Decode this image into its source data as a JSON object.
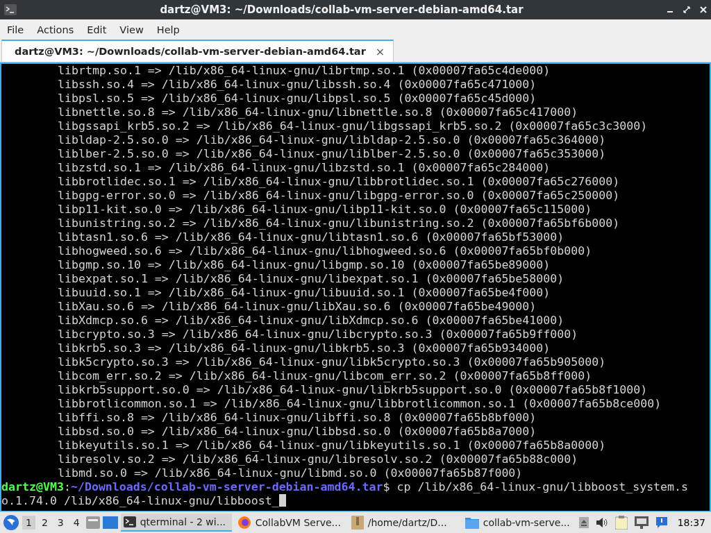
{
  "window": {
    "title": "dartz@VM3: ~/Downloads/collab-vm-server-debian-amd64.tar"
  },
  "menu": [
    "File",
    "Actions",
    "Edit",
    "View",
    "Help"
  ],
  "tabs": [
    {
      "label": "dartz@VM3: ~/Downloads/collab-vm-server-debian-amd64.tar",
      "selected": true,
      "close": "×"
    }
  ],
  "terminal": {
    "lines": [
      "librtmp.so.1 => /lib/x86_64-linux-gnu/librtmp.so.1 (0x00007fa65c4de000)",
      "libssh.so.4 => /lib/x86_64-linux-gnu/libssh.so.4 (0x00007fa65c471000)",
      "libpsl.so.5 => /lib/x86_64-linux-gnu/libpsl.so.5 (0x00007fa65c45d000)",
      "libnettle.so.8 => /lib/x86_64-linux-gnu/libnettle.so.8 (0x00007fa65c417000)",
      "libgssapi_krb5.so.2 => /lib/x86_64-linux-gnu/libgssapi_krb5.so.2 (0x00007fa65c3c3000)",
      "libldap-2.5.so.0 => /lib/x86_64-linux-gnu/libldap-2.5.so.0 (0x00007fa65c364000)",
      "liblber-2.5.so.0 => /lib/x86_64-linux-gnu/liblber-2.5.so.0 (0x00007fa65c353000)",
      "libzstd.so.1 => /lib/x86_64-linux-gnu/libzstd.so.1 (0x00007fa65c284000)",
      "libbrotlidec.so.1 => /lib/x86_64-linux-gnu/libbrotlidec.so.1 (0x00007fa65c276000)",
      "libgpg-error.so.0 => /lib/x86_64-linux-gnu/libgpg-error.so.0 (0x00007fa65c250000)",
      "libp11-kit.so.0 => /lib/x86_64-linux-gnu/libp11-kit.so.0 (0x00007fa65c115000)",
      "libunistring.so.2 => /lib/x86_64-linux-gnu/libunistring.so.2 (0x00007fa65bf6b000)",
      "libtasn1.so.6 => /lib/x86_64-linux-gnu/libtasn1.so.6 (0x00007fa65bf53000)",
      "libhogweed.so.6 => /lib/x86_64-linux-gnu/libhogweed.so.6 (0x00007fa65bf0b000)",
      "libgmp.so.10 => /lib/x86_64-linux-gnu/libgmp.so.10 (0x00007fa65be89000)",
      "libexpat.so.1 => /lib/x86_64-linux-gnu/libexpat.so.1 (0x00007fa65be58000)",
      "libuuid.so.1 => /lib/x86_64-linux-gnu/libuuid.so.1 (0x00007fa65be4f000)",
      "libXau.so.6 => /lib/x86_64-linux-gnu/libXau.so.6 (0x00007fa65be49000)",
      "libXdmcp.so.6 => /lib/x86_64-linux-gnu/libXdmcp.so.6 (0x00007fa65be41000)",
      "libcrypto.so.3 => /lib/x86_64-linux-gnu/libcrypto.so.3 (0x00007fa65b9ff000)",
      "libkrb5.so.3 => /lib/x86_64-linux-gnu/libkrb5.so.3 (0x00007fa65b934000)",
      "libk5crypto.so.3 => /lib/x86_64-linux-gnu/libk5crypto.so.3 (0x00007fa65b905000)",
      "libcom_err.so.2 => /lib/x86_64-linux-gnu/libcom_err.so.2 (0x00007fa65b8ff000)",
      "libkrb5support.so.0 => /lib/x86_64-linux-gnu/libkrb5support.so.0 (0x00007fa65b8f1000)",
      "libbrotlicommon.so.1 => /lib/x86_64-linux-gnu/libbrotlicommon.so.1 (0x00007fa65b8ce000)",
      "libffi.so.8 => /lib/x86_64-linux-gnu/libffi.so.8 (0x00007fa65b8bf000)",
      "libbsd.so.0 => /lib/x86_64-linux-gnu/libbsd.so.0 (0x00007fa65b8a7000)",
      "libkeyutils.so.1 => /lib/x86_64-linux-gnu/libkeyutils.so.1 (0x00007fa65b8a0000)",
      "libresolv.so.2 => /lib/x86_64-linux-gnu/libresolv.so.2 (0x00007fa65b88c000)",
      "libmd.so.0 => /lib/x86_64-linux-gnu/libmd.so.0 (0x00007fa65b87f000)"
    ],
    "prompt": {
      "user": "dartz@VM3",
      "separator": ":",
      "path": "~/Downloads/collab-vm-server-debian-amd64.tar",
      "command": "$ cp /lib/x86_64-linux-gnu/libboost_system.s",
      "continuation": "o.1.74.0 /lib/x86_64-linux-gnu/libboost_"
    }
  },
  "taskbar": {
    "workspaces": [
      {
        "label": "1",
        "selected": true
      },
      {
        "label": "2",
        "selected": false
      },
      {
        "label": "3",
        "selected": false
      },
      {
        "label": "4",
        "selected": false
      }
    ],
    "tasks": [
      {
        "label": "qterminal - 2 wi...",
        "kind": "terminal",
        "selected": true
      },
      {
        "label": "CollabVM Serve...",
        "kind": "browser",
        "selected": false
      },
      {
        "label": "/home/dartz/D...",
        "kind": "archive",
        "selected": false
      },
      {
        "label": "collab-vm-serve...",
        "kind": "folder",
        "selected": false
      }
    ],
    "clock": "18:37"
  }
}
